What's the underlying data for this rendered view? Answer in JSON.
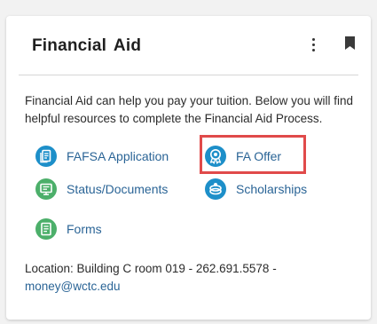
{
  "card": {
    "title": "Financial Aid",
    "description": "Financial Aid can help you pay your tuition. Below you will find helpful resources to complete the Financial Aid Process.",
    "links": [
      {
        "label": "FAFSA Application",
        "icon": "application-icon",
        "color": "#1d8fc9"
      },
      {
        "label": "FA Offer",
        "icon": "offer-ribbon-icon",
        "color": "#1d8fc9"
      },
      {
        "label": "Status/Documents",
        "icon": "documents-icon",
        "color": "#4caf6a"
      },
      {
        "label": "Scholarships",
        "icon": "scholarship-icon",
        "color": "#1d8fc9"
      },
      {
        "label": "Forms",
        "icon": "forms-icon",
        "color": "#4caf6a"
      }
    ],
    "location_text": "Location: Building C room 019 - 262.691.5578 -",
    "email": "money@wctc.edu"
  },
  "colors": {
    "accent_blue": "#1d8fc9",
    "accent_green": "#4caf6a",
    "link_text": "#2a6496",
    "highlight": "#e04a4a"
  }
}
